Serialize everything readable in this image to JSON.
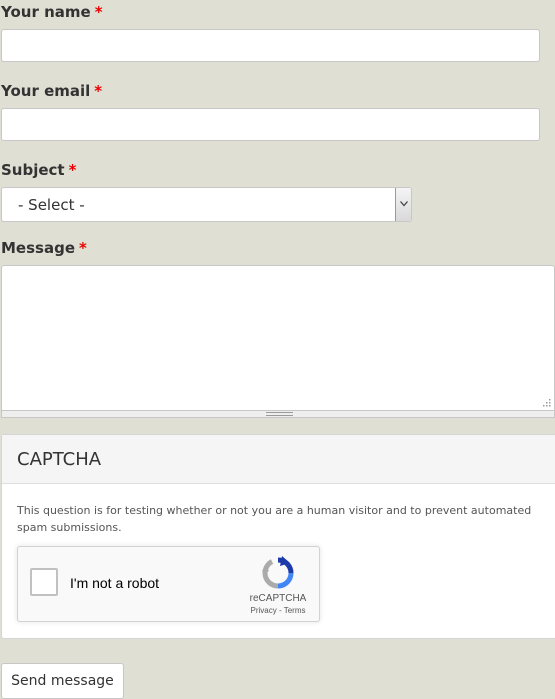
{
  "form": {
    "name_label": "Your name",
    "email_label": "Your email",
    "subject_label": "Subject",
    "message_label": "Message",
    "required_marker": "*",
    "name_value": "",
    "email_value": "",
    "subject_selected": "- Select -",
    "message_value": "",
    "submit_label": "Send message"
  },
  "captcha": {
    "title": "CAPTCHA",
    "description": "This question is for testing whether or not you are a human visitor and to prevent automated spam submissions.",
    "checkbox_label": "I'm not a robot",
    "brand": "reCAPTCHA",
    "privacy_link": "Privacy",
    "separator": " - ",
    "terms_link": "Terms"
  },
  "colors": {
    "page_background": "#dfdfd4",
    "required": "#ee0000",
    "panel_header": "#f5f5f5"
  },
  "icons": [
    "chevron-down-icon",
    "resize-grip-icon",
    "recaptcha-logo-icon"
  ]
}
